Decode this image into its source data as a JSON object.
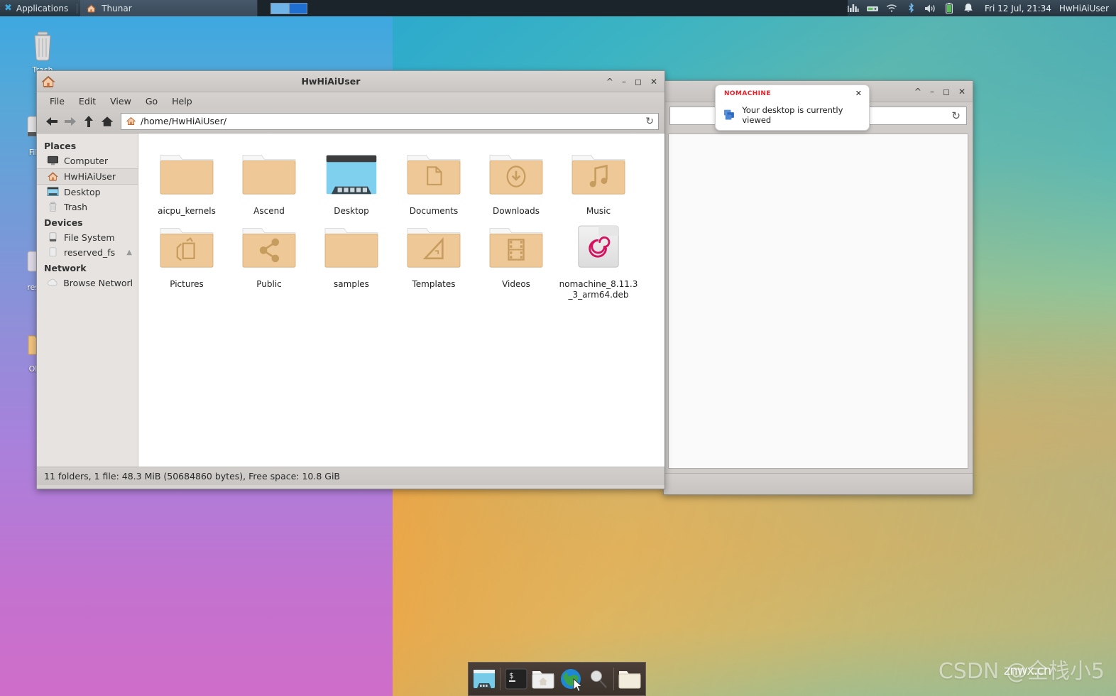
{
  "panel": {
    "applications_label": "Applications",
    "task_label": "Thunar",
    "clock": "Fri 12 Jul, 21:34",
    "user": "HwHiAiUser",
    "tray_icons": [
      "equalizer-icon",
      "network-icon",
      "wifi-icon",
      "bluetooth-icon",
      "volume-icon",
      "battery-icon",
      "notification-bell-icon"
    ],
    "workspaces": [
      "workspace-1",
      "workspace-2"
    ],
    "active_workspace": 2
  },
  "desktop_icons": [
    {
      "name": "Trash",
      "label": "Trash",
      "icon": "trash-icon"
    },
    {
      "name": "File System",
      "label": "File",
      "icon": "drive-icon"
    },
    {
      "name": "reserved_fs",
      "label": "rese",
      "icon": "drive-icon"
    },
    {
      "name": "Old",
      "label": "Old",
      "icon": "folder-icon"
    }
  ],
  "thunar": {
    "title": "HwHiAiUser",
    "window_buttons": [
      "shade",
      "minimize",
      "maximize",
      "close"
    ],
    "menu": [
      "File",
      "Edit",
      "View",
      "Go",
      "Help"
    ],
    "toolbar": {
      "back": "←",
      "forward": "→",
      "up": "↑",
      "home": "⌂",
      "reload": "↻"
    },
    "path": "/home/HwHiAiUser/",
    "sidebar": {
      "groups": [
        {
          "title": "Places",
          "items": [
            {
              "label": "Computer",
              "icon": "computer-icon",
              "selected": false
            },
            {
              "label": "HwHiAiUser",
              "icon": "home-icon",
              "selected": true
            },
            {
              "label": "Desktop",
              "icon": "desktop-icon",
              "selected": false
            },
            {
              "label": "Trash",
              "icon": "trash-icon",
              "selected": false
            }
          ]
        },
        {
          "title": "Devices",
          "items": [
            {
              "label": "File System",
              "icon": "drive-icon",
              "selected": false
            },
            {
              "label": "reserved_fs",
              "icon": "drive-icon",
              "selected": false,
              "eject": true
            }
          ]
        },
        {
          "title": "Network",
          "items": [
            {
              "label": "Browse Network",
              "icon": "network-cloud-icon",
              "selected": false
            }
          ]
        }
      ]
    },
    "files": [
      {
        "name": "aicpu_kernels",
        "type": "folder",
        "glyph": "plain"
      },
      {
        "name": "Ascend",
        "type": "folder",
        "glyph": "plain"
      },
      {
        "name": "Desktop",
        "type": "folder",
        "glyph": "desktop"
      },
      {
        "name": "Documents",
        "type": "folder",
        "glyph": "document"
      },
      {
        "name": "Downloads",
        "type": "folder",
        "glyph": "download"
      },
      {
        "name": "Music",
        "type": "folder",
        "glyph": "music"
      },
      {
        "name": "Pictures",
        "type": "folder",
        "glyph": "picture"
      },
      {
        "name": "Public",
        "type": "folder",
        "glyph": "share"
      },
      {
        "name": "samples",
        "type": "folder",
        "glyph": "plain"
      },
      {
        "name": "Templates",
        "type": "folder",
        "glyph": "template"
      },
      {
        "name": "Videos",
        "type": "folder",
        "glyph": "video"
      },
      {
        "name": "nomachine_8.11.3_3_arm64.deb",
        "type": "deb-package",
        "glyph": "debian"
      }
    ],
    "status": "11 folders, 1 file: 48.3 MiB (50684860 bytes), Free space: 10.8 GiB"
  },
  "background_window": {
    "window_buttons": [
      "shade",
      "minimize",
      "maximize",
      "close"
    ],
    "reload": "↻"
  },
  "notification": {
    "brand": "NOMACHINE",
    "message": "Your desktop is currently viewed",
    "close": "✕",
    "brand_color": "#e8202a"
  },
  "dock": {
    "items": [
      {
        "name": "show-desktop",
        "icon": "desktop-window-icon"
      },
      {
        "name": "terminal",
        "icon": "terminal-icon"
      },
      {
        "name": "file-manager",
        "icon": "home-folder-icon"
      },
      {
        "name": "web-browser",
        "icon": "globe-icon"
      },
      {
        "name": "search",
        "icon": "magnifier-icon"
      },
      {
        "name": "files",
        "icon": "folder-icon"
      }
    ]
  },
  "watermark": {
    "text": "CSDN @全栈小5",
    "overlay": "znwx.cn"
  }
}
